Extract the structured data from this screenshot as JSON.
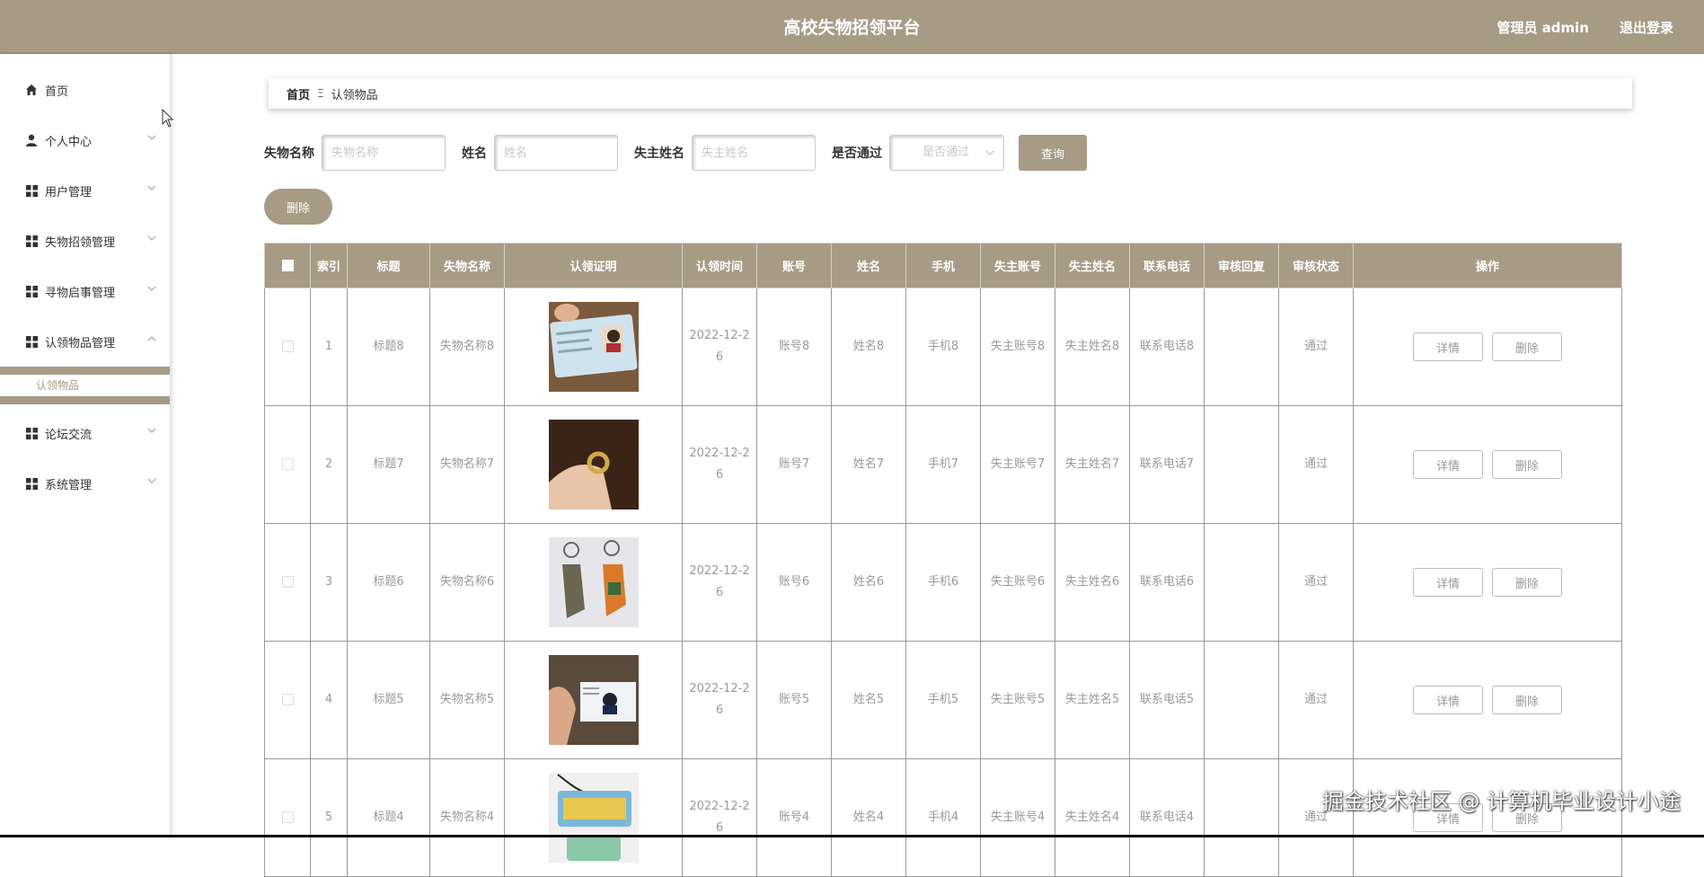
{
  "header": {
    "title": "高校失物招领平台",
    "admin": "管理员 admin",
    "logout": "退出登录"
  },
  "sidebar": {
    "items": [
      {
        "label": "首页",
        "icon": "home-icon"
      },
      {
        "label": "个人中心",
        "icon": "user-icon"
      },
      {
        "label": "用户管理",
        "icon": "grid-icon"
      },
      {
        "label": "失物招领管理",
        "icon": "grid-icon"
      },
      {
        "label": "寻物启事管理",
        "icon": "grid-icon"
      },
      {
        "label": "认领物品管理",
        "icon": "grid-icon"
      },
      {
        "label": "论坛交流",
        "icon": "grid-icon"
      },
      {
        "label": "系统管理",
        "icon": "grid-icon"
      }
    ],
    "submenu": [
      "认领物品"
    ]
  },
  "breadcrumb": {
    "home": "首页",
    "separator": "Ξ",
    "current": "认领物品"
  },
  "search": {
    "item_name_label": "失物名称",
    "item_name_placeholder": "失物名称",
    "name_label": "姓名",
    "name_placeholder": "姓名",
    "owner_name_label": "失主姓名",
    "owner_name_placeholder": "失主姓名",
    "approved_label": "是否通过",
    "approved_placeholder": "是否通过",
    "query_button": "查询"
  },
  "batch_delete": "删除",
  "table": {
    "headers": [
      "索引",
      "标题",
      "失物名称",
      "认领证明",
      "认领时间",
      "账号",
      "姓名",
      "手机",
      "失主账号",
      "失主姓名",
      "联系电话",
      "审核回复",
      "审核状态",
      "操作"
    ],
    "detail_label": "详情",
    "delete_label": "删除",
    "rows": [
      {
        "index": "1",
        "title": "标题8",
        "item_name": "失物名称8",
        "proof": "id-card",
        "time": "2022-12-26",
        "account": "账号8",
        "name": "姓名8",
        "phone": "手机8",
        "owner_account": "失主账号8",
        "owner_name": "失主姓名8",
        "contact": "联系电话8",
        "reply": "",
        "status": "通过"
      },
      {
        "index": "2",
        "title": "标题7",
        "item_name": "失物名称7",
        "proof": "ring",
        "time": "2022-12-26",
        "account": "账号7",
        "name": "姓名7",
        "phone": "手机7",
        "owner_account": "失主账号7",
        "owner_name": "失主姓名7",
        "contact": "联系电话7",
        "reply": "",
        "status": "通过"
      },
      {
        "index": "3",
        "title": "标题6",
        "item_name": "失物名称6",
        "proof": "keychains",
        "time": "2022-12-26",
        "account": "账号6",
        "name": "姓名6",
        "phone": "手机6",
        "owner_account": "失主账号6",
        "owner_name": "失主姓名6",
        "contact": "联系电话6",
        "reply": "",
        "status": "通过"
      },
      {
        "index": "4",
        "title": "标题5",
        "item_name": "失物名称5",
        "proof": "id-card-hand",
        "time": "2022-12-26",
        "account": "账号5",
        "name": "姓名5",
        "phone": "手机5",
        "owner_account": "失主账号5",
        "owner_name": "失主姓名5",
        "contact": "联系电话5",
        "reply": "",
        "status": "通过"
      },
      {
        "index": "5",
        "title": "标题4",
        "item_name": "失物名称4",
        "proof": "card-tag",
        "time": "2022-12-26",
        "account": "账号4",
        "name": "姓名4",
        "phone": "手机4",
        "owner_account": "失主账号4",
        "owner_name": "失主姓名4",
        "contact": "联系电话4",
        "reply": "",
        "status": "通过"
      }
    ]
  },
  "watermark": "掘金技术社区 @ 计算机毕业设计小途",
  "colors": {
    "accent": "#a89b86"
  }
}
